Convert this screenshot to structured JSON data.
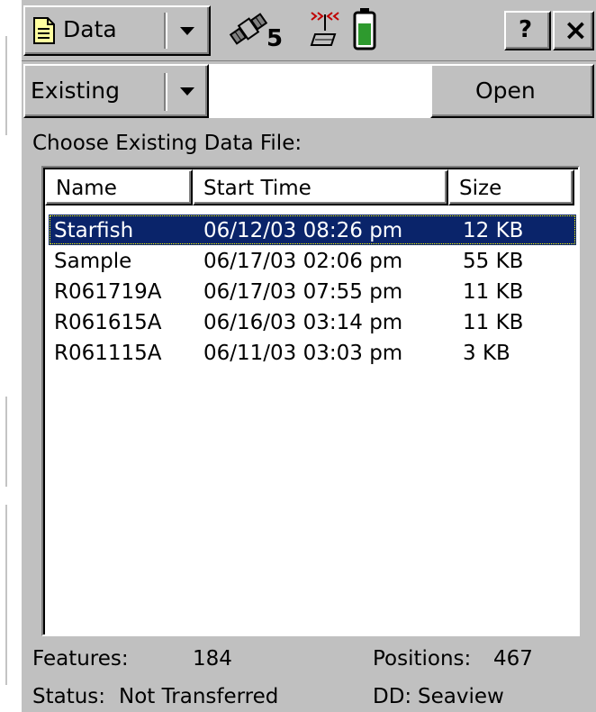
{
  "toolbar": {
    "menu_label": "Data",
    "satellite_count": "5",
    "help_label": "?",
    "close_label": "×"
  },
  "subbar": {
    "mode_value": "Existing",
    "open_label": "Open"
  },
  "prompt": "Choose Existing Data File:",
  "table": {
    "headers": [
      "Name",
      "Start Time",
      "Size"
    ],
    "rows": [
      {
        "name": "Starfish",
        "start": "06/12/03 08:26 pm",
        "size": "12 KB"
      },
      {
        "name": "Sample",
        "start": "06/17/03 02:06 pm",
        "size": "55 KB"
      },
      {
        "name": "R061719A",
        "start": "06/17/03 07:55 pm",
        "size": "11 KB"
      },
      {
        "name": "R061615A",
        "start": "06/16/03 03:14 pm",
        "size": "11 KB"
      },
      {
        "name": "R061115A",
        "start": "06/11/03 03:03 pm",
        "size": "3 KB"
      }
    ],
    "selected_index": 0
  },
  "footer": {
    "features_label": "Features:",
    "features_value": "184",
    "positions_label": "Positions:",
    "positions_value": "467",
    "status_label": "Status:",
    "status_value": "Not Transferred",
    "dd_label": "DD:",
    "dd_value": "Seaview"
  },
  "colors": {
    "selection": "#0a246a",
    "battery_fill": "#2e9a2e"
  },
  "icons": [
    "document-icon",
    "satellite-icon",
    "antenna-icon",
    "battery-icon",
    "dropdown-arrow-icon"
  ]
}
